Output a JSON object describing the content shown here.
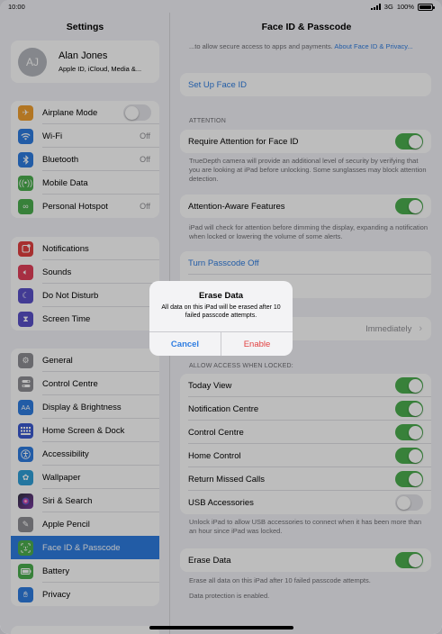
{
  "status": {
    "time": "10:00",
    "network": "3G",
    "battery": "100%"
  },
  "sidebar": {
    "title": "Settings",
    "profile": {
      "initials": "AJ",
      "name": "Alan Jones",
      "subtitle": "Apple ID, iCloud, Media &..."
    },
    "groups": [
      [
        {
          "label": "Airplane Mode",
          "icon": "airplane-icon",
          "color": "#f0a030",
          "toggle": "off"
        },
        {
          "label": "Wi-Fi",
          "icon": "wifi-icon",
          "color": "#2f7de1",
          "value": "Off"
        },
        {
          "label": "Bluetooth",
          "icon": "bluetooth-icon",
          "color": "#2f7de1",
          "value": "Off"
        },
        {
          "label": "Mobile Data",
          "icon": "antenna-icon",
          "color": "#4cae4f"
        },
        {
          "label": "Personal Hotspot",
          "icon": "hotspot-icon",
          "color": "#4cae4f",
          "value": "Off"
        }
      ],
      [
        {
          "label": "Notifications",
          "icon": "notifications-icon",
          "color": "#e24040"
        },
        {
          "label": "Sounds",
          "icon": "speaker-icon",
          "color": "#e2405a"
        },
        {
          "label": "Do Not Disturb",
          "icon": "moon-icon",
          "color": "#5a50c8"
        },
        {
          "label": "Screen Time",
          "icon": "hourglass-icon",
          "color": "#5a50c8"
        }
      ],
      [
        {
          "label": "General",
          "icon": "gear-icon",
          "color": "#8e8e93"
        },
        {
          "label": "Control Centre",
          "icon": "switches-icon",
          "color": "#8e8e93"
        },
        {
          "label": "Display & Brightness",
          "icon": "text-size-icon",
          "color": "#2f7de1"
        },
        {
          "label": "Home Screen & Dock",
          "icon": "grid-icon",
          "color": "#3a5ad0"
        },
        {
          "label": "Accessibility",
          "icon": "accessibility-icon",
          "color": "#2f7de1"
        },
        {
          "label": "Wallpaper",
          "icon": "flower-icon",
          "color": "#30a0d8"
        },
        {
          "label": "Siri & Search",
          "icon": "siri-icon",
          "color": "#303040"
        },
        {
          "label": "Apple Pencil",
          "icon": "pencil-icon",
          "color": "#8e8e93"
        },
        {
          "label": "Face ID & Passcode",
          "icon": "face-id-icon",
          "color": "#4cae4f",
          "selected": true
        },
        {
          "label": "Battery",
          "icon": "battery-icon",
          "color": "#4cae4f"
        },
        {
          "label": "Privacy",
          "icon": "hand-icon",
          "color": "#2f7de1"
        }
      ]
    ]
  },
  "detail": {
    "title": "Face ID & Passcode",
    "intro_text": "...to allow secure access to apps and payments.",
    "intro_link": "About Face ID & Privacy...",
    "setup_face_id": "Set Up Face ID",
    "attention_header": "ATTENTION",
    "require_attention": "Require Attention for Face ID",
    "require_attention_footer": "TrueDepth camera will provide an additional level of security by verifying that you are looking at iPad before unlocking. Some sunglasses may block attention detection.",
    "attention_aware": "Attention-Aware Features",
    "attention_aware_footer": "iPad will check for attention before dimming the display, expanding a notification when locked or lowering the volume of some alerts.",
    "turn_passcode_off": "Turn Passcode Off",
    "require_passcode_value": "Immediately",
    "allow_access_header": "ALLOW ACCESS WHEN LOCKED:",
    "locked_access": [
      {
        "label": "Today View",
        "toggle": "on"
      },
      {
        "label": "Notification Centre",
        "toggle": "on"
      },
      {
        "label": "Control Centre",
        "toggle": "on"
      },
      {
        "label": "Home Control",
        "toggle": "on"
      },
      {
        "label": "Return Missed Calls",
        "toggle": "on"
      },
      {
        "label": "USB Accessories",
        "toggle": "off"
      }
    ],
    "usb_footer": "Unlock iPad to allow USB accessories to connect when it has been more than an hour since iPad was locked.",
    "erase_data": "Erase Data",
    "erase_footer": "Erase all data on this iPad after 10 failed passcode attempts.",
    "protection_footer": "Data protection is enabled."
  },
  "alert": {
    "title": "Erase Data",
    "message": "All data on this iPad will be erased after 10 failed passcode attempts.",
    "cancel": "Cancel",
    "enable": "Enable"
  }
}
